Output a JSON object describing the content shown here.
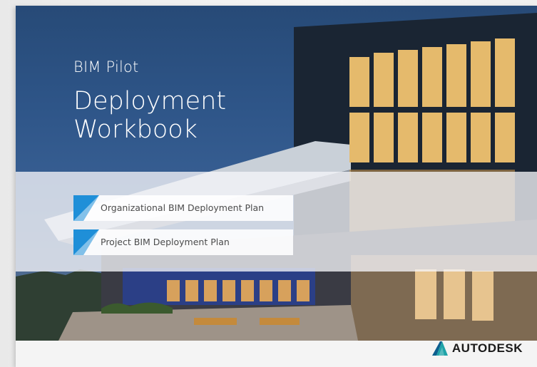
{
  "cover": {
    "subtitle": "BIM Pilot",
    "title_line1": "Deployment",
    "title_line2": "Workbook"
  },
  "links": [
    {
      "label": "Organizational BIM Deployment Plan"
    },
    {
      "label": "Project BIM Deployment Plan"
    }
  ],
  "brand": {
    "name": "AUTODESK",
    "logo_icon": "autodesk-logo-icon"
  },
  "colors": {
    "accent": "#1f8fd8",
    "sky_top": "#274a77",
    "footer": "#f4f4f4"
  }
}
